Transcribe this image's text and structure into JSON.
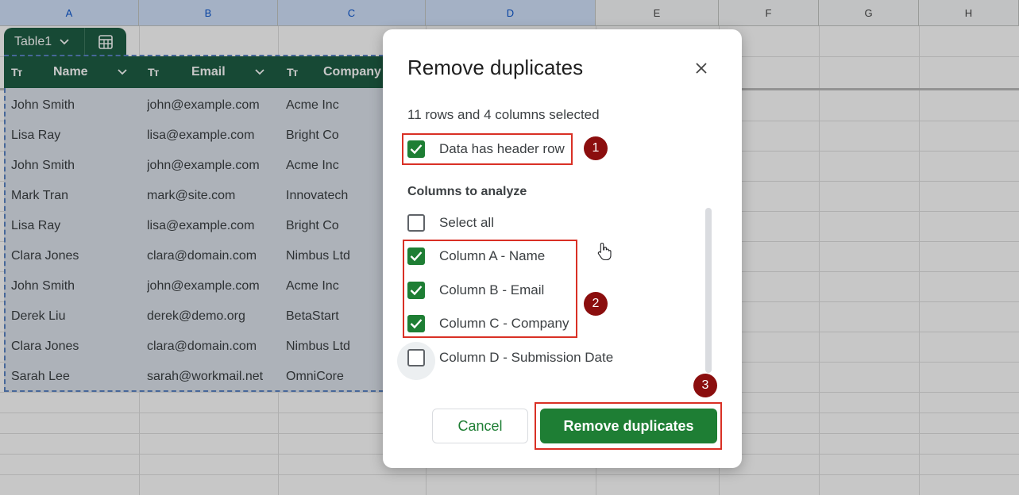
{
  "sheet": {
    "columns": [
      "A",
      "B",
      "C",
      "D",
      "E",
      "F",
      "G",
      "H"
    ],
    "table_name": "Table1",
    "headers": [
      {
        "type_icon": "Tт",
        "label": "Name"
      },
      {
        "type_icon": "Tт",
        "label": "Email"
      },
      {
        "type_icon": "Tт",
        "label": "Company"
      }
    ],
    "rows": [
      [
        "John Smith",
        "john@example.com",
        "Acme Inc"
      ],
      [
        "Lisa Ray",
        "lisa@example.com",
        "Bright Co"
      ],
      [
        "John Smith",
        "john@example.com",
        "Acme Inc"
      ],
      [
        "Mark Tran",
        "mark@site.com",
        "Innovatech"
      ],
      [
        "Lisa Ray",
        "lisa@example.com",
        "Bright Co"
      ],
      [
        "Clara Jones",
        "clara@domain.com",
        "Nimbus Ltd"
      ],
      [
        "John Smith",
        "john@example.com",
        "Acme Inc"
      ],
      [
        "Derek Liu",
        "derek@demo.org",
        "BetaStart"
      ],
      [
        "Clara Jones",
        "clara@domain.com",
        "Nimbus Ltd"
      ],
      [
        "Sarah Lee",
        "sarah@workmail.net",
        "OmniCore"
      ]
    ]
  },
  "dialog": {
    "title": "Remove duplicates",
    "summary": "11 rows and 4 columns selected",
    "header_row": {
      "label": "Data has header row",
      "checked": true
    },
    "section_title": "Columns to analyze",
    "options": [
      {
        "label": "Select all",
        "checked": false
      },
      {
        "label": "Column A - Name",
        "checked": true
      },
      {
        "label": "Column B - Email",
        "checked": true
      },
      {
        "label": "Column C - Company",
        "checked": true
      },
      {
        "label": "Column D - Submission Date",
        "checked": false
      }
    ],
    "cancel_label": "Cancel",
    "confirm_label": "Remove duplicates"
  },
  "annotations": {
    "badges": [
      "1",
      "2",
      "3"
    ]
  },
  "colors": {
    "table_header_bg": "#1e5e44",
    "primary_green": "#1e7e34",
    "highlight_red": "#d93025",
    "badge_bg": "#8b0e0e"
  }
}
